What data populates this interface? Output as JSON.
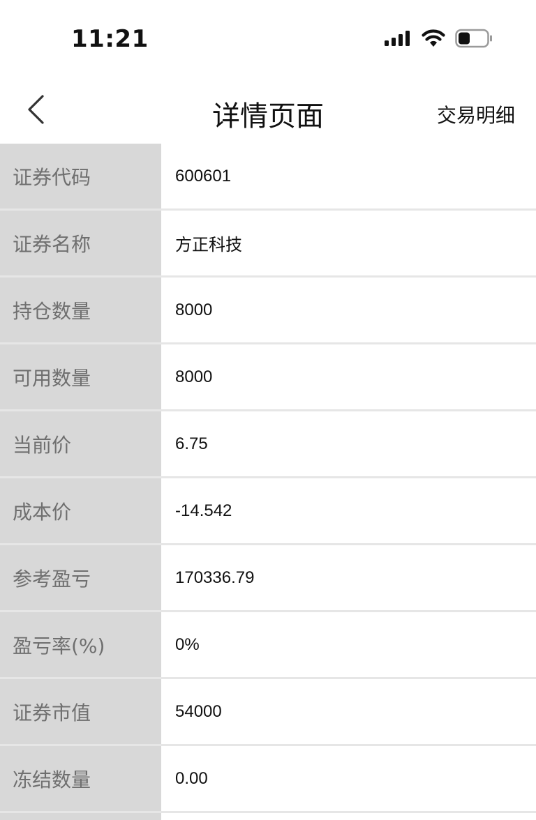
{
  "status_bar": {
    "time": "11:21",
    "icons": [
      "cellular-signal-icon",
      "wifi-icon",
      "battery-icon"
    ]
  },
  "nav": {
    "back_icon": "chevron-left-icon",
    "title": "详情页面",
    "action_label": "交易明细"
  },
  "details": [
    {
      "label": "证券代码",
      "value": "600601"
    },
    {
      "label": "证券名称",
      "value": "方正科技"
    },
    {
      "label": "持仓数量",
      "value": "8000"
    },
    {
      "label": "可用数量",
      "value": "8000"
    },
    {
      "label": "当前价",
      "value": "6.75"
    },
    {
      "label": "成本价",
      "value": "-14.542"
    },
    {
      "label": "参考盈亏",
      "value": "170336.79"
    },
    {
      "label": "盈亏率(%)",
      "value": "0%"
    },
    {
      "label": "证券市值",
      "value": "54000"
    },
    {
      "label": "冻结数量",
      "value": "0.00"
    }
  ],
  "colors": {
    "label_background": "#d8d8d8",
    "label_text": "#6f6f6f",
    "divider": "#e6e6e6",
    "text": "#111111"
  }
}
